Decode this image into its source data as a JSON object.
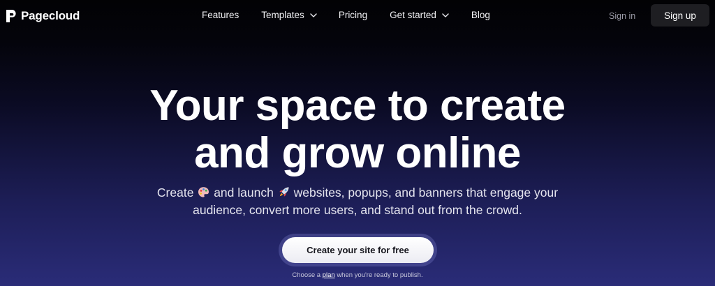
{
  "brand": {
    "name": "Pagecloud",
    "logo_icon": "pagecloud-logo-icon"
  },
  "nav": {
    "items": [
      {
        "label": "Features",
        "has_dropdown": false
      },
      {
        "label": "Templates",
        "has_dropdown": true
      },
      {
        "label": "Pricing",
        "has_dropdown": false
      },
      {
        "label": "Get started",
        "has_dropdown": true
      },
      {
        "label": "Blog",
        "has_dropdown": false
      }
    ],
    "signin_label": "Sign in",
    "signup_label": "Sign up"
  },
  "hero": {
    "title_line1": "Your space to create",
    "title_line2": "and grow online",
    "subtitle": {
      "part1": "Create",
      "emoji1": "artist-palette-emoji",
      "part2": "and launch",
      "emoji2": "rocket-emoji",
      "part3": "websites, popups, and banners that engage your audience, convert more users, and stand out from the crowd."
    },
    "cta_label": "Create your site for free",
    "note": {
      "before": "Choose a",
      "link": "plan",
      "after": "when you're ready to publish."
    }
  },
  "colors": {
    "background_top": "#020204",
    "background_bottom": "#2a2c78",
    "signup_bg": "#1e1e22",
    "cta_bg": "#ffffff",
    "cta_text": "#16161d"
  }
}
